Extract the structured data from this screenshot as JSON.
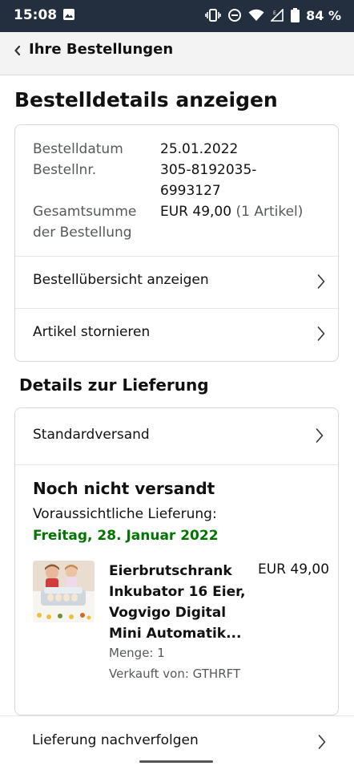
{
  "status_bar": {
    "time": "15:08",
    "battery_percent": "84 %",
    "icons": [
      "image-icon",
      "vibrate-icon",
      "do-not-disturb-icon",
      "wifi-icon",
      "signal-icon",
      "battery-icon"
    ]
  },
  "nav": {
    "back_label": "Ihre Bestellungen"
  },
  "page": {
    "title": "Bestelldetails anzeigen"
  },
  "order": {
    "date_label": "Bestelldatum",
    "date_value": "25.01.2022",
    "number_label": "Bestellnr.",
    "number_value_line1": "305-8192035-",
    "number_value_line2": "6993127",
    "total_label_line1": "Gesamtsumme",
    "total_label_line2": "der Bestellung",
    "total_value": "EUR 49,00",
    "total_items": "(1 Artikel)",
    "links": [
      {
        "label": "Bestellübersicht anzeigen"
      },
      {
        "label": "Artikel stornieren"
      }
    ]
  },
  "delivery": {
    "section_title": "Details zur Lieferung",
    "shipping_method": "Standardversand",
    "status": "Noch nicht versandt",
    "expected_label": "Voraussichtliche Lieferung:",
    "expected_date": "Freitag, 28. Januar 2022",
    "item": {
      "title_line1": "Eierbrutschrank",
      "title_line2": "Inkubator 16 Eier,",
      "title_line3": "Vogvigo Digital",
      "title_line4": "Mini Automatik...",
      "price": "EUR 49,00",
      "quantity": "Menge: 1",
      "seller": "Verkauft von: GTHRFT"
    }
  },
  "tracking": {
    "label": "Lieferung nachverfolgen"
  },
  "colors": {
    "status_bar": "#232f3e",
    "delivery_date": "#007600",
    "muted_text": "#565959",
    "border": "#d5d9d9"
  }
}
